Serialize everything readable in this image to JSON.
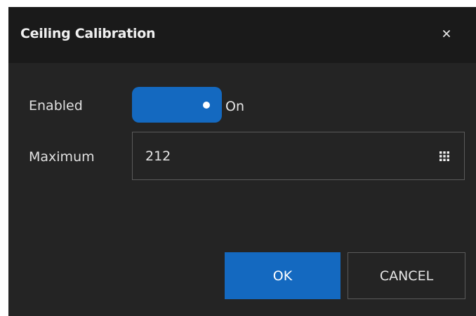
{
  "dialog": {
    "title": "Ceiling Calibration",
    "close_icon": "close-icon"
  },
  "fields": {
    "enabled": {
      "label": "Enabled",
      "state_text": "On",
      "checked": true
    },
    "maximum": {
      "label": "Maximum",
      "value": "212",
      "keypad_icon": "keypad-icon"
    }
  },
  "buttons": {
    "ok_label": "OK",
    "cancel_label": "CANCEL"
  },
  "colors": {
    "accent": "#1469c0",
    "dialog_bg": "#242424",
    "titlebar_bg": "#1a1a1a",
    "text": "#e6e6e6",
    "border": "#5a5a5a"
  }
}
